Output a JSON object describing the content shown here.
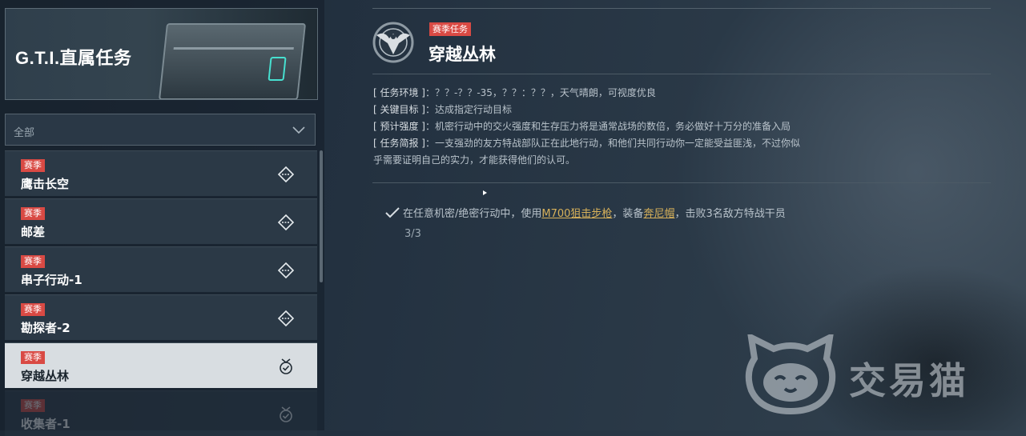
{
  "banner": {
    "title": "G.T.I.直属任务"
  },
  "filter": {
    "selected": "全部"
  },
  "missions": [
    {
      "badge": "赛季",
      "name": "鹰击长空",
      "status": "locked"
    },
    {
      "badge": "赛季",
      "name": "邮差",
      "status": "locked"
    },
    {
      "badge": "赛季",
      "name": "串子行动-1",
      "status": "locked"
    },
    {
      "badge": "赛季",
      "name": "勘探者-2",
      "status": "locked"
    },
    {
      "badge": "赛季",
      "name": "穿越丛林",
      "status": "completed",
      "selected": true
    },
    {
      "badge": "赛季",
      "name": "收集者-1",
      "status": "completed"
    }
  ],
  "detail": {
    "tag": "赛季任务",
    "title": "穿越丛林",
    "info": [
      {
        "key": "[ 任务环境 ]",
        "value": "：？？-？？-35，？？：？？，天气晴朗，可视度优良"
      },
      {
        "key": "[ 关键目标 ]",
        "value": "：达成指定行动目标"
      },
      {
        "key": "[ 预计强度 ]",
        "value": "：机密行动中的交火强度和生存压力将是通常战场的数倍，务必做好十万分的准备入局"
      },
      {
        "key": "[ 任务简报 ]",
        "value": "：一支强劲的友方特战部队正在此地行动，和他们共同行动你一定能受益匪浅，不过你似"
      }
    ],
    "info_continuation": "乎需要证明自己的实力，才能获得他们的认可。",
    "objective": {
      "prefix": "在任意机密/绝密行动中，使用",
      "weapon": "M700狙击步枪",
      "middle": "，装备",
      "gear": "奔尼帽",
      "suffix": "，击败3名敌方特战干员",
      "progress": "3/3"
    }
  },
  "watermark": {
    "text": "交易猫"
  },
  "colors": {
    "badge": "#d94a44",
    "highlight": "#d9b25a",
    "selected_row": "#d8dde1"
  }
}
